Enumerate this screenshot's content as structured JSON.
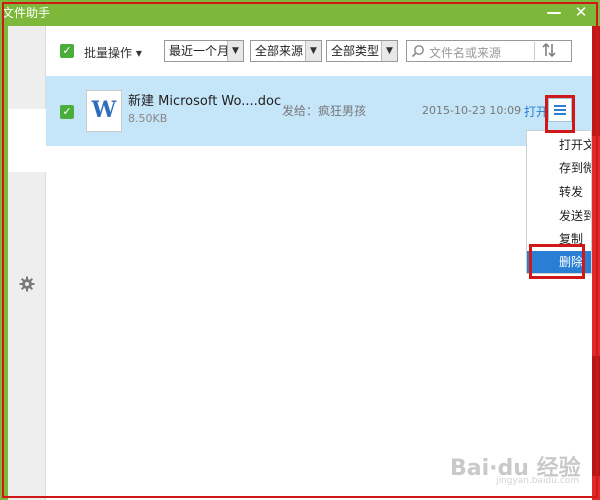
{
  "window": {
    "title": "文件助手",
    "minimize_label": "—",
    "close_label": "✕",
    "colors": {
      "titlebar": "#7db83a",
      "accent": "#2a7fd4",
      "selected_row": "#c5e5f8",
      "highlight_box": "#d01818"
    }
  },
  "sidebar": {
    "settings_icon": "gear-icon"
  },
  "toolbar": {
    "batch_label": "批量操作 ▾",
    "filters": [
      {
        "value": "最近一个月"
      },
      {
        "value": "全部来源"
      },
      {
        "value": "全部类型"
      }
    ],
    "search_placeholder": "文件名或来源",
    "sort_icon": "sort-icon"
  },
  "files": [
    {
      "checked": true,
      "name": "新建 Microsoft Wo....doc",
      "size": "8.50KB",
      "sent_to": "发给：疯狂男孩",
      "date": "2015-10-23 10:09",
      "open_label": "打开"
    }
  ],
  "context_menu": {
    "items": [
      {
        "label": "打开文件夹"
      },
      {
        "label": "存到微云"
      },
      {
        "label": "转发"
      },
      {
        "label": "发送到手机"
      },
      {
        "label": "复制"
      },
      {
        "label": "删除",
        "selected": true
      }
    ]
  },
  "watermark": {
    "text": "Bai·du 经验",
    "sub": "jingyan.baidu.com"
  }
}
